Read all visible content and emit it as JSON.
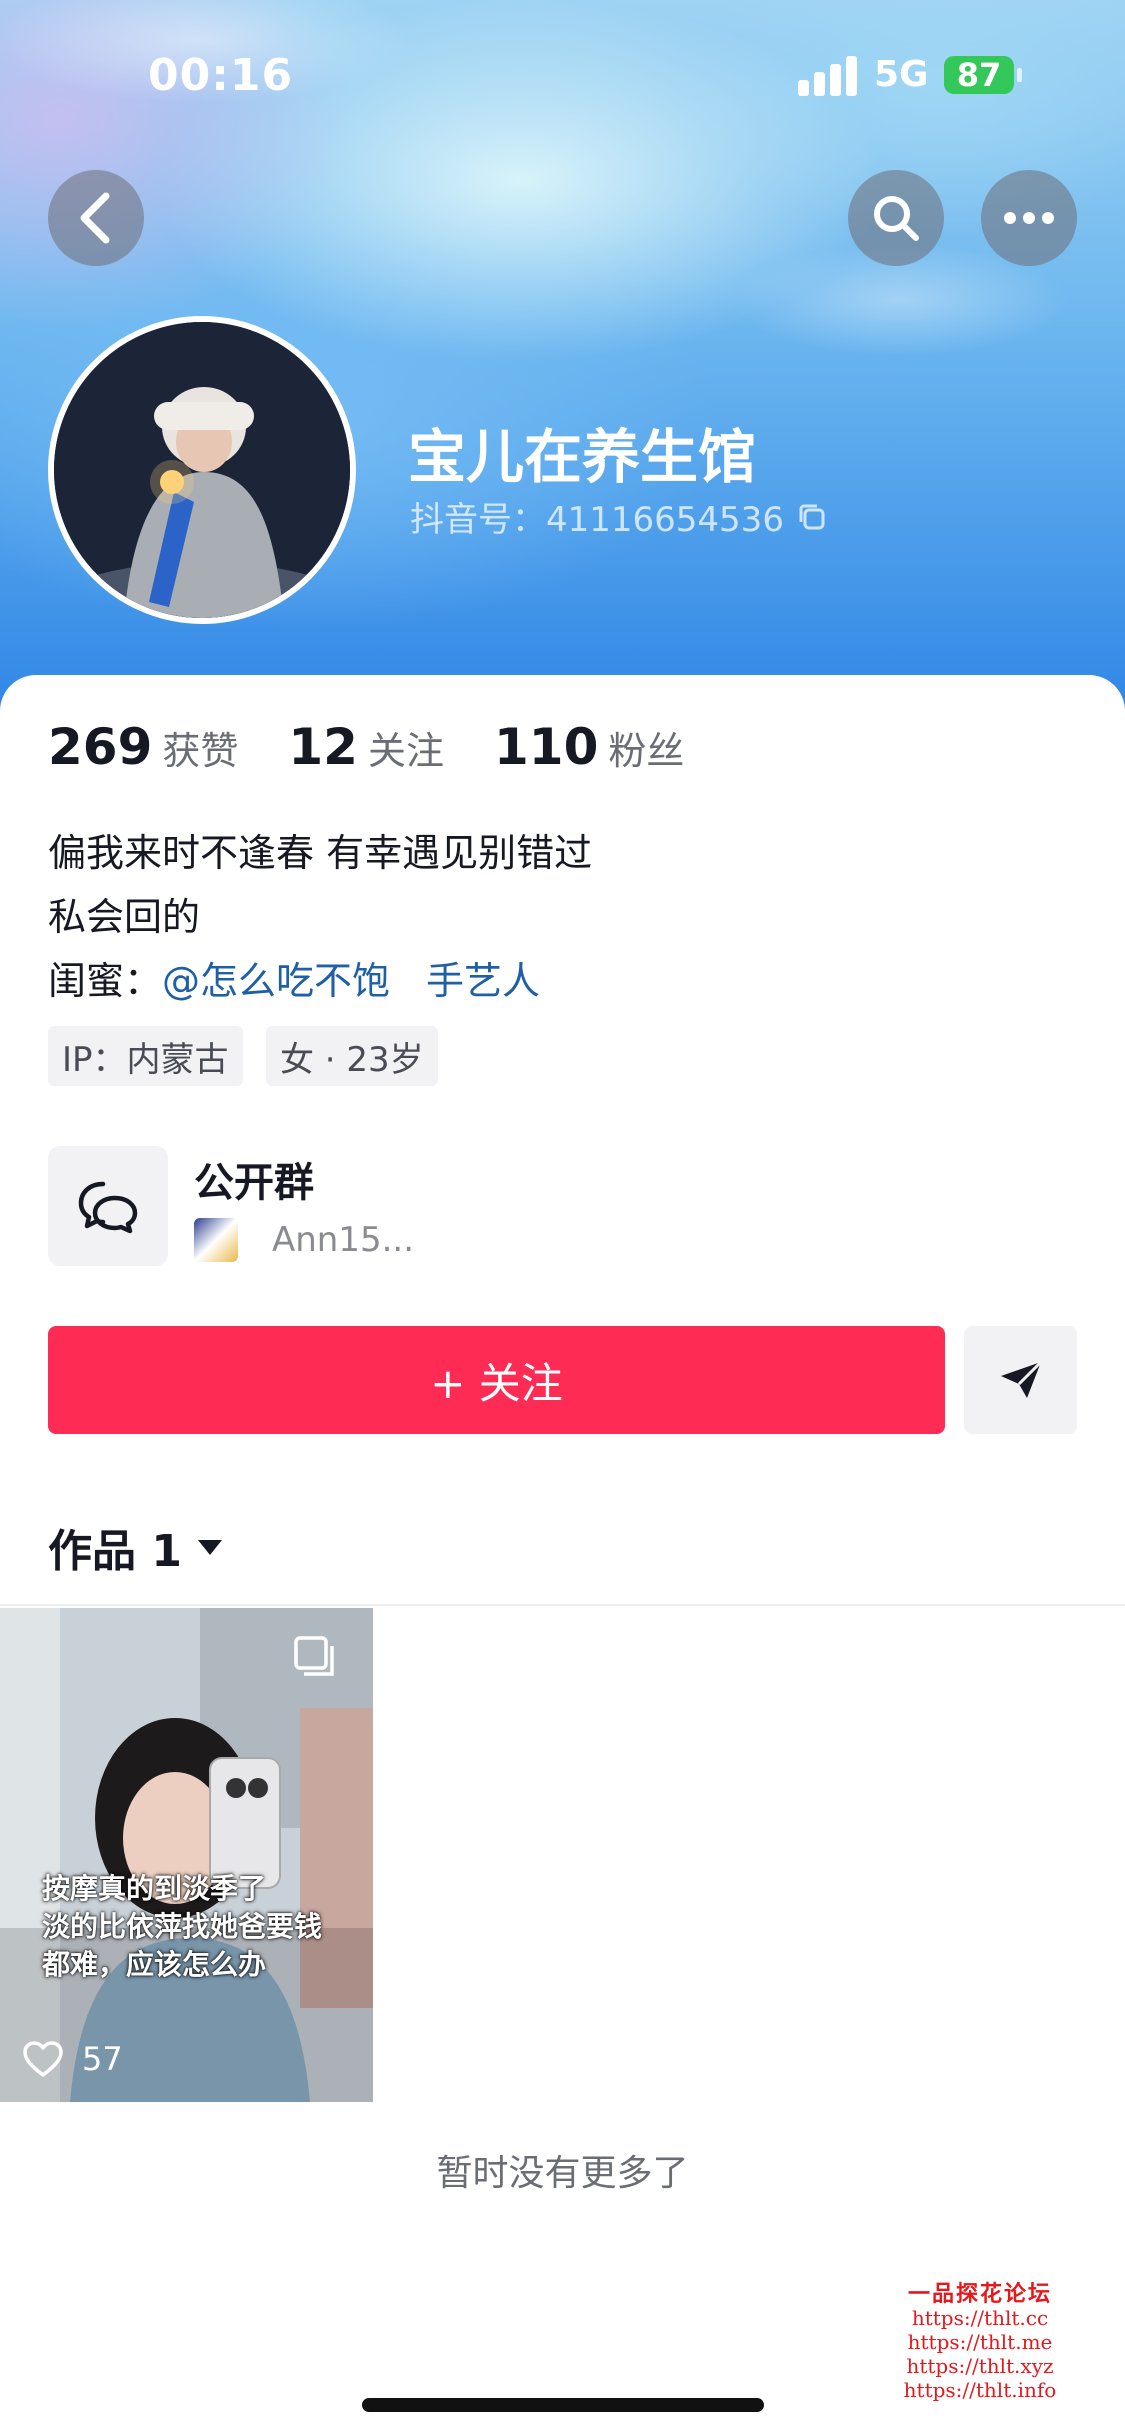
{
  "status_bar": {
    "time": "00:16",
    "network": "5G",
    "battery": "87"
  },
  "profile": {
    "nickname": "宝儿在养生馆",
    "douyin_id": "抖音号：41116654536"
  },
  "stats": [
    {
      "value": "269",
      "label": "获赞"
    },
    {
      "value": "12",
      "label": "关注"
    },
    {
      "value": "110",
      "label": "粉丝"
    }
  ],
  "bio": {
    "line1": "偏我来时不逢春 有幸遇见别错过",
    "line2": "私会回的",
    "bestie_prefix": "闺蜜：",
    "bestie_mention": "@怎么吃不饱",
    "bestie_extra": "手艺人"
  },
  "tags": [
    "IP：内蒙古",
    "女 · 23岁"
  ],
  "group": {
    "title": "公开群",
    "member": "Ann15..."
  },
  "actions": {
    "follow_label": "+ 关注"
  },
  "works_tab": {
    "label": "作品 1"
  },
  "videos": [
    {
      "caption_lines": [
        "按摩真的到淡季了",
        "淡的比依萍找她爸要钱",
        "都难，应该怎么办"
      ],
      "likes": "57"
    }
  ],
  "footer": {
    "no_more": "暂时没有更多了"
  },
  "watermark": {
    "title": "一品探花论坛",
    "links": [
      "https://thlt.cc",
      "https://thlt.me",
      "https://thlt.xyz",
      "https://thlt.info"
    ]
  },
  "colors": {
    "follow_button": "#fe2c55",
    "mention": "#1f5fa6",
    "battery": "#34c759"
  },
  "icons": [
    "back-arrow-icon",
    "search-icon",
    "more-icon",
    "copy-icon",
    "chat-bubbles-icon",
    "send-arrow-icon",
    "dropdown-triangle-icon",
    "heart-icon",
    "multi-image-icon"
  ]
}
